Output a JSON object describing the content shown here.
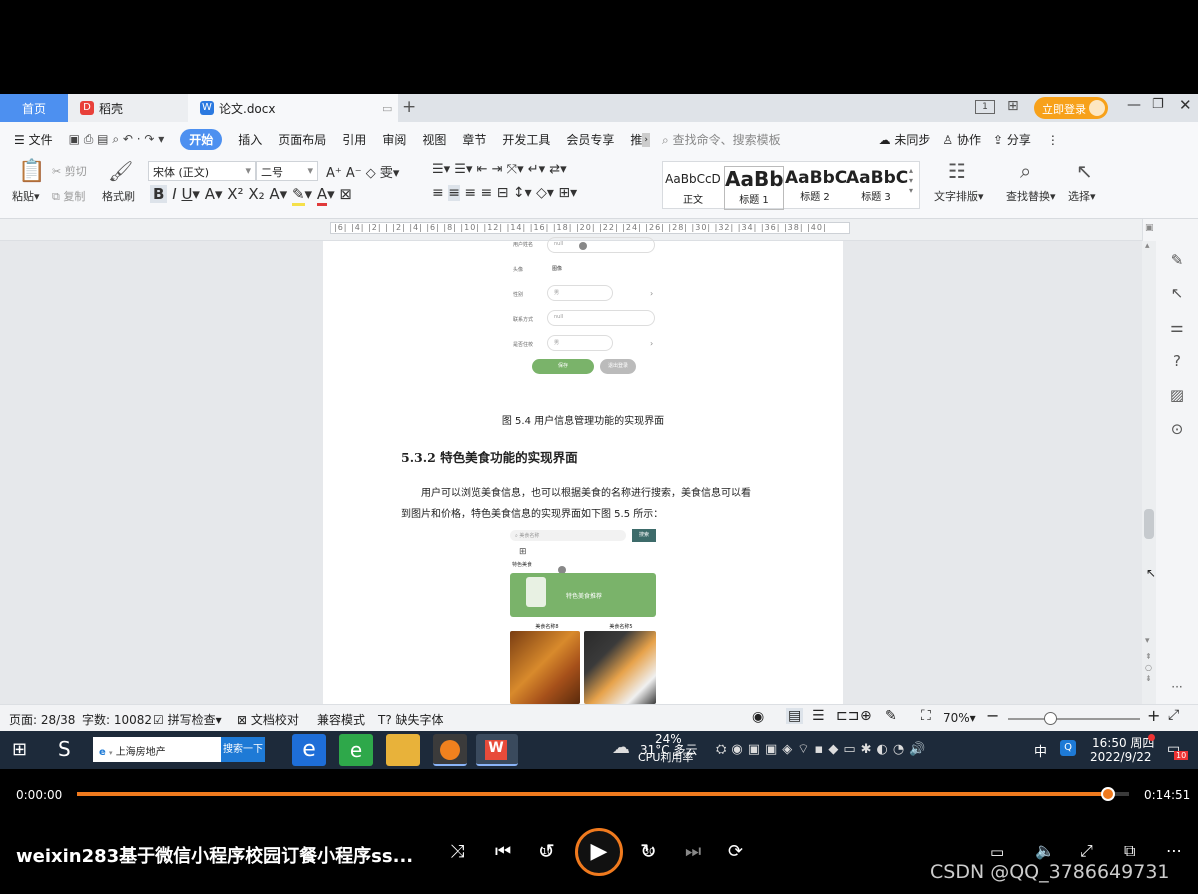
{
  "tabs": {
    "home": "首页",
    "daoke": "稻壳",
    "doc": "论文.docx",
    "login": "立即登录"
  },
  "menu": {
    "file": "文件",
    "items": [
      "开始",
      "插入",
      "页面布局",
      "引用",
      "审阅",
      "视图",
      "章节",
      "开发工具",
      "会员专享",
      "推"
    ],
    "search_placeholder": "查找命令、搜索模板",
    "sync": "未同步",
    "collab": "协作",
    "share": "分享"
  },
  "ribbon": {
    "paste": "粘贴",
    "cut": "剪切",
    "copy": "复制",
    "format_painter": "格式刷",
    "font_name": "宋体 (正文)",
    "font_size": "二号",
    "styles": [
      {
        "preview": "AaBbCcD",
        "name": "正文"
      },
      {
        "preview": "AaBb",
        "name": "标题 1"
      },
      {
        "preview": "AaBbC",
        "name": "标题 2"
      },
      {
        "preview": "AaBbC",
        "name": "标题 3"
      }
    ],
    "text_layout": "文字排版",
    "find_replace": "查找替换",
    "select": "选择"
  },
  "ruler_ticks": "|6| |4| |2| | |2| |4| |6| |8| |10| |12| |14| |16| |18| |20| |22| |24| |26| |28| |30| |32| |34| |36| |38| |40|",
  "document": {
    "form_labels": [
      "用户姓名",
      "头像",
      "性别",
      "联系方式",
      "是否住校"
    ],
    "form_values": [
      "null",
      "图像",
      "男",
      "null",
      "男"
    ],
    "save_button": "保存",
    "logout_button": "退出登录",
    "figure_caption": "图 5.4 用户信息管理功能的实现界面",
    "heading": "5.3.2 特色美食功能的实现界面",
    "paragraph_line1": "用户可以浏览美食信息，也可以根据美食的名称进行搜索，美食信息可以看",
    "paragraph_line2": "到图片和价格，特色美食信息的实现界面如下图 5.5 所示：",
    "mock_search_placeholder": "美食名称",
    "mock_search_button": "搜索",
    "mock_category": "特色美食",
    "mock_banner": "特色美食推荐",
    "mock_item1": "美食名称8",
    "mock_item2": "美食名称5"
  },
  "status": {
    "page": "页面: 28/38",
    "words": "字数: 10082",
    "spell": "拼写检查",
    "proof": "文档校对",
    "compat": "兼容模式",
    "missing_font": "缺失字体",
    "zoom": "70%"
  },
  "taskbar": {
    "search_text": "上海房地产",
    "search_button": "搜索一下",
    "cpu_percent": "24%",
    "cpu_label": "CPU利用率",
    "weather": "31°C 多云",
    "ime": "中",
    "time": "16:50 周四",
    "date": "2022/9/22",
    "notif_count": "10"
  },
  "player": {
    "elapsed": "0:00:00",
    "duration": "0:14:51",
    "progress_fraction": 0.98,
    "title": "weixin283基于微信小程序校园订餐小程序ss...",
    "rewind_label": "10",
    "forward_label": "30",
    "watermark": "CSDN @QQ_3786649731"
  },
  "colors": {
    "accent": "#4d90f0",
    "player_progress": "#f07a1e",
    "login": "#f7a11a",
    "mock_green": "#7ab36a"
  }
}
